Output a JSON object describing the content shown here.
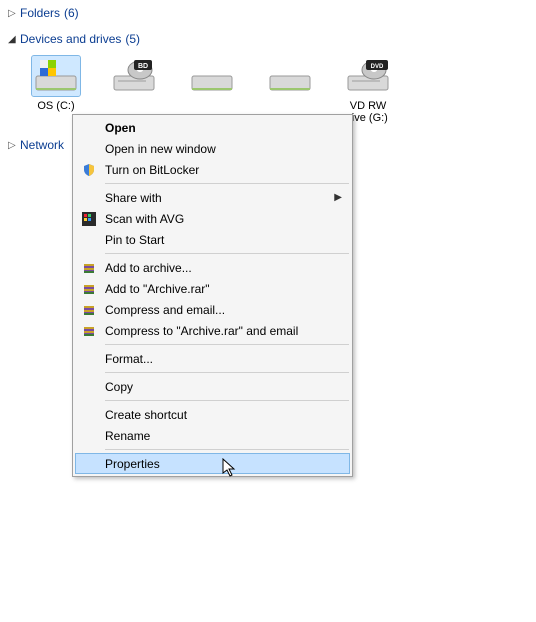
{
  "sections": {
    "folders": {
      "arrow": "▷",
      "title": "Folders",
      "count": "(6)"
    },
    "devices": {
      "arrow": "◢",
      "title": "Devices and drives",
      "count": "(5)"
    },
    "network": {
      "arrow": "▷",
      "title": "Network",
      "count": ""
    }
  },
  "drives": {
    "selected_label": "OS (C:)",
    "dvd_line1": "VD RW",
    "dvd_line2": "rive (G:)"
  },
  "menu": {
    "open": "Open",
    "open_new_window": "Open in new window",
    "turn_on_bitlocker": "Turn on BitLocker",
    "share_with": "Share with",
    "scan_with_avg": "Scan with AVG",
    "pin_to_start": "Pin to Start",
    "add_to_archive": "Add to archive...",
    "add_to_archive_rar": "Add to \"Archive.rar\"",
    "compress_and_email": "Compress and email...",
    "compress_to_rar_and_email": "Compress to \"Archive.rar\" and email",
    "format": "Format...",
    "copy": "Copy",
    "create_shortcut": "Create shortcut",
    "rename": "Rename",
    "properties": "Properties"
  },
  "icons": {
    "bd_badge": "BD",
    "dvd_badge": "DVD"
  }
}
